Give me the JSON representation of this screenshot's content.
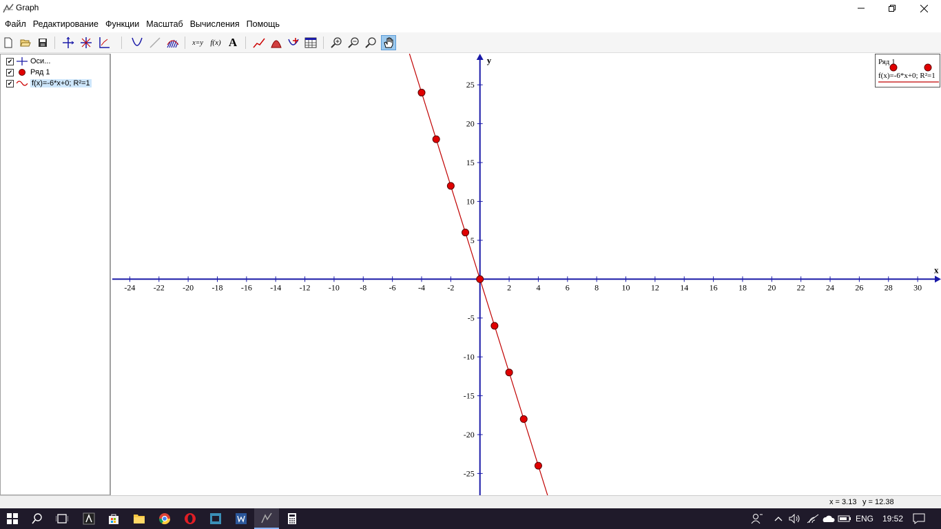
{
  "window": {
    "title": "Graph"
  },
  "menu": [
    "Файл",
    "Редактирование",
    "Функции",
    "Масштаб",
    "Вычисления",
    "Помощь"
  ],
  "toolbar": {
    "xy_label": "x=y",
    "fx_label": "f(x)",
    "text_label": "A",
    "active_tool": "pan-hand-icon"
  },
  "sidebar": {
    "items": [
      {
        "label": "Оси...",
        "checked": true,
        "icon": "axes-icon"
      },
      {
        "label": "Ряд 1",
        "checked": true,
        "icon": "red-point-icon"
      },
      {
        "label": "f(x)=-6*x+0; R²=1",
        "checked": true,
        "icon": "trendline-icon",
        "selected": true
      }
    ]
  },
  "legend": {
    "series_label": "Ряд 1",
    "trend_label": "f(x)=-6*x+0; R²=1"
  },
  "status": {
    "x_readout": "x = 3.13",
    "y_readout": "y = 12.38"
  },
  "taskbar": {
    "lang": "ENG",
    "time": "19:52"
  },
  "colors": {
    "axis": "#1a1aa8",
    "series": "#e00000",
    "trendline": "#c00000"
  },
  "chart_data": {
    "type": "scatter",
    "xlabel": "x",
    "ylabel": "y",
    "xlim": [
      -25.2,
      31.6
    ],
    "ylim": [
      -27.8,
      29.0
    ],
    "xticks": [
      -24,
      -22,
      -20,
      -18,
      -16,
      -14,
      -12,
      -10,
      -8,
      -6,
      -4,
      -2,
      2,
      4,
      6,
      8,
      10,
      12,
      14,
      16,
      18,
      20,
      22,
      24,
      26,
      28,
      30
    ],
    "yticks": [
      -25,
      -20,
      -15,
      -10,
      -5,
      5,
      10,
      15,
      20,
      25
    ],
    "series": [
      {
        "name": "Ряд 1",
        "x": [
          -4,
          -3,
          -2,
          -1,
          0,
          1,
          2,
          3,
          4
        ],
        "y": [
          24,
          18,
          12,
          6,
          0,
          -6,
          -12,
          -18,
          -24
        ]
      }
    ],
    "trendline": {
      "name": "f(x)=-6*x+0; R²=1",
      "slope": -6,
      "intercept": 0
    },
    "grid": false,
    "legend_position": "top-right"
  }
}
